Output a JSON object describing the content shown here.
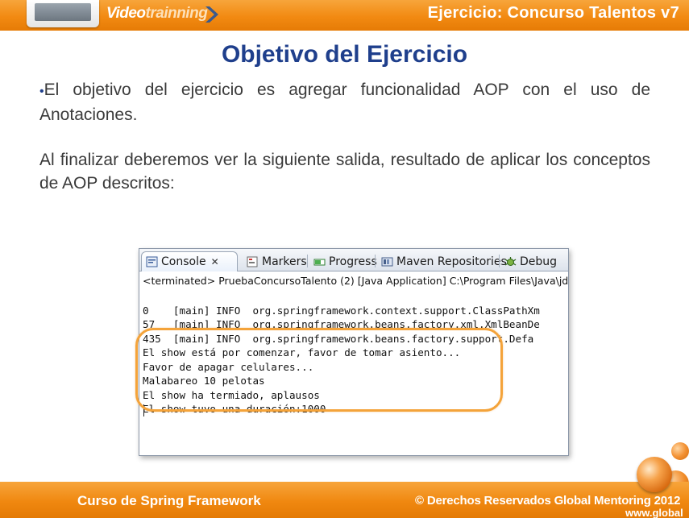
{
  "header": {
    "brand_part1": "Video",
    "brand_part2": "trainning",
    "title": "Ejercicio: Concurso Talentos v7"
  },
  "slide": {
    "title": "Objetivo del Ejercicio",
    "bullet": "•",
    "paragraph1": "El objetivo del ejercicio es agregar funcionalidad AOP con el uso de Anotaciones.",
    "paragraph2": "Al finalizar deberemos ver la siguiente salida, resultado de aplicar los conceptos de AOP descritos:"
  },
  "eclipse": {
    "tabs": [
      {
        "label": "Console",
        "icon": "console-icon",
        "close": "✕"
      },
      {
        "label": "Markers",
        "icon": "markers-icon"
      },
      {
        "label": "Progress",
        "icon": "progress-icon"
      },
      {
        "label": "Maven Repositories",
        "icon": "maven-repositories-icon"
      },
      {
        "label": "Debug",
        "icon": "debug-icon"
      }
    ],
    "terminated_line": "<terminated> PruebaConcursoTalento (2) [Java Application] C:\\Program Files\\Java\\jd",
    "log_lines": [
      "0    [main] INFO  org.springframework.context.support.ClassPathXm",
      "57   [main] INFO  org.springframework.beans.factory.xml.XmlBeanDe",
      "435  [main] INFO  org.springframework.beans.factory.support.Defa"
    ],
    "output_lines": [
      "El show está por comenzar, favor de tomar asiento...",
      "Favor de apagar celulares...",
      "Malabareo 10 pelotas",
      "El show ha termiado, aplausos",
      "El show tuvo una duración:1000"
    ]
  },
  "footer": {
    "course": "Curso de Spring Framework",
    "rights": "© Derechos Reservados Global Mentoring 2012",
    "url": "www.global"
  },
  "colors": {
    "brand_orange": "#f28a12",
    "title_blue": "#1f3f8c",
    "highlight_orange": "#f4a33a"
  }
}
